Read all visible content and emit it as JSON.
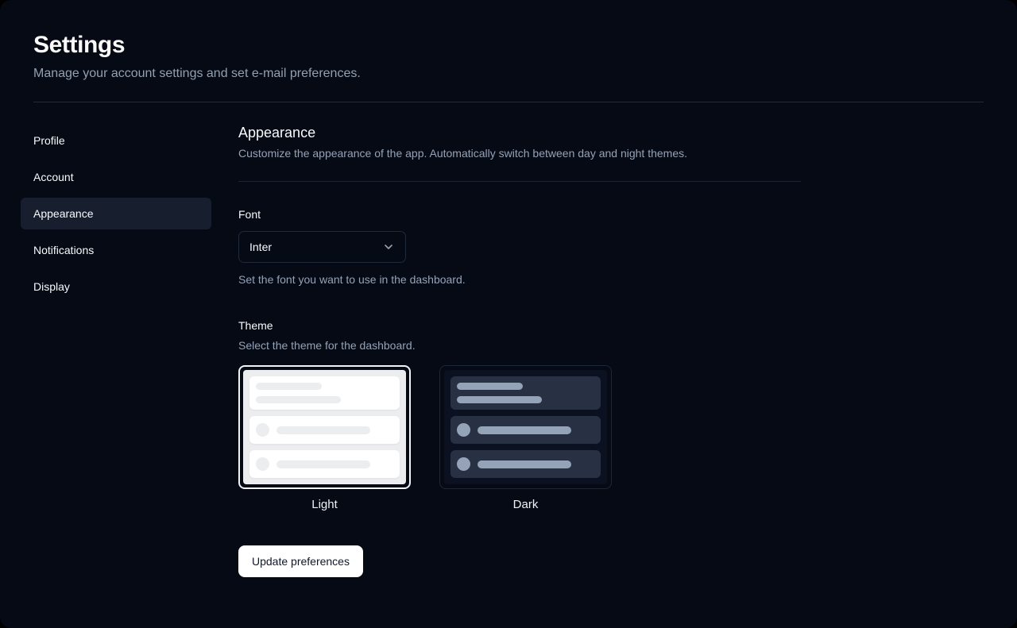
{
  "header": {
    "title": "Settings",
    "subtitle": "Manage your account settings and set e-mail preferences."
  },
  "sidebar": {
    "items": [
      {
        "label": "Profile",
        "active": false
      },
      {
        "label": "Account",
        "active": false
      },
      {
        "label": "Appearance",
        "active": true
      },
      {
        "label": "Notifications",
        "active": false
      },
      {
        "label": "Display",
        "active": false
      }
    ]
  },
  "section": {
    "title": "Appearance",
    "description": "Customize the appearance of the app. Automatically switch between day and night themes."
  },
  "form": {
    "font": {
      "label": "Font",
      "selected_option": "Inter",
      "chevron_icon": "chevron-down-icon",
      "help": "Set the font you want to use in the dashboard."
    },
    "theme": {
      "label": "Theme",
      "description": "Select the theme for the dashboard.",
      "options": [
        {
          "label": "Light",
          "selected": true
        },
        {
          "label": "Dark",
          "selected": false
        }
      ]
    },
    "submit_label": "Update preferences"
  },
  "colors": {
    "frame_bg": "#000000",
    "page_bg": "#050a15",
    "text_primary": "#f8fafc",
    "text_muted": "#94a3b8",
    "border": "#202a3b",
    "active_nav_bg": "#171f2f",
    "selected_ring": "#f1f3f6",
    "light_preview_bg": "#ecedef",
    "dark_preview_panel": "#0b1120",
    "dark_preview_row": "#273143",
    "dark_preview_bar": "#94a3b8",
    "button_bg": "#ffffff",
    "button_text": "#0f172a"
  }
}
